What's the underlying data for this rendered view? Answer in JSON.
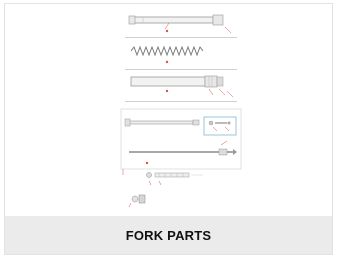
{
  "product": {
    "title": "FORK PARTS",
    "image_icon": "fork-parts-diagram-icon"
  },
  "colors": {
    "caption_bg": "#ebebeb",
    "line": "#9a9a9a",
    "callout": "#d9534f",
    "box": "#7fb6d6"
  }
}
